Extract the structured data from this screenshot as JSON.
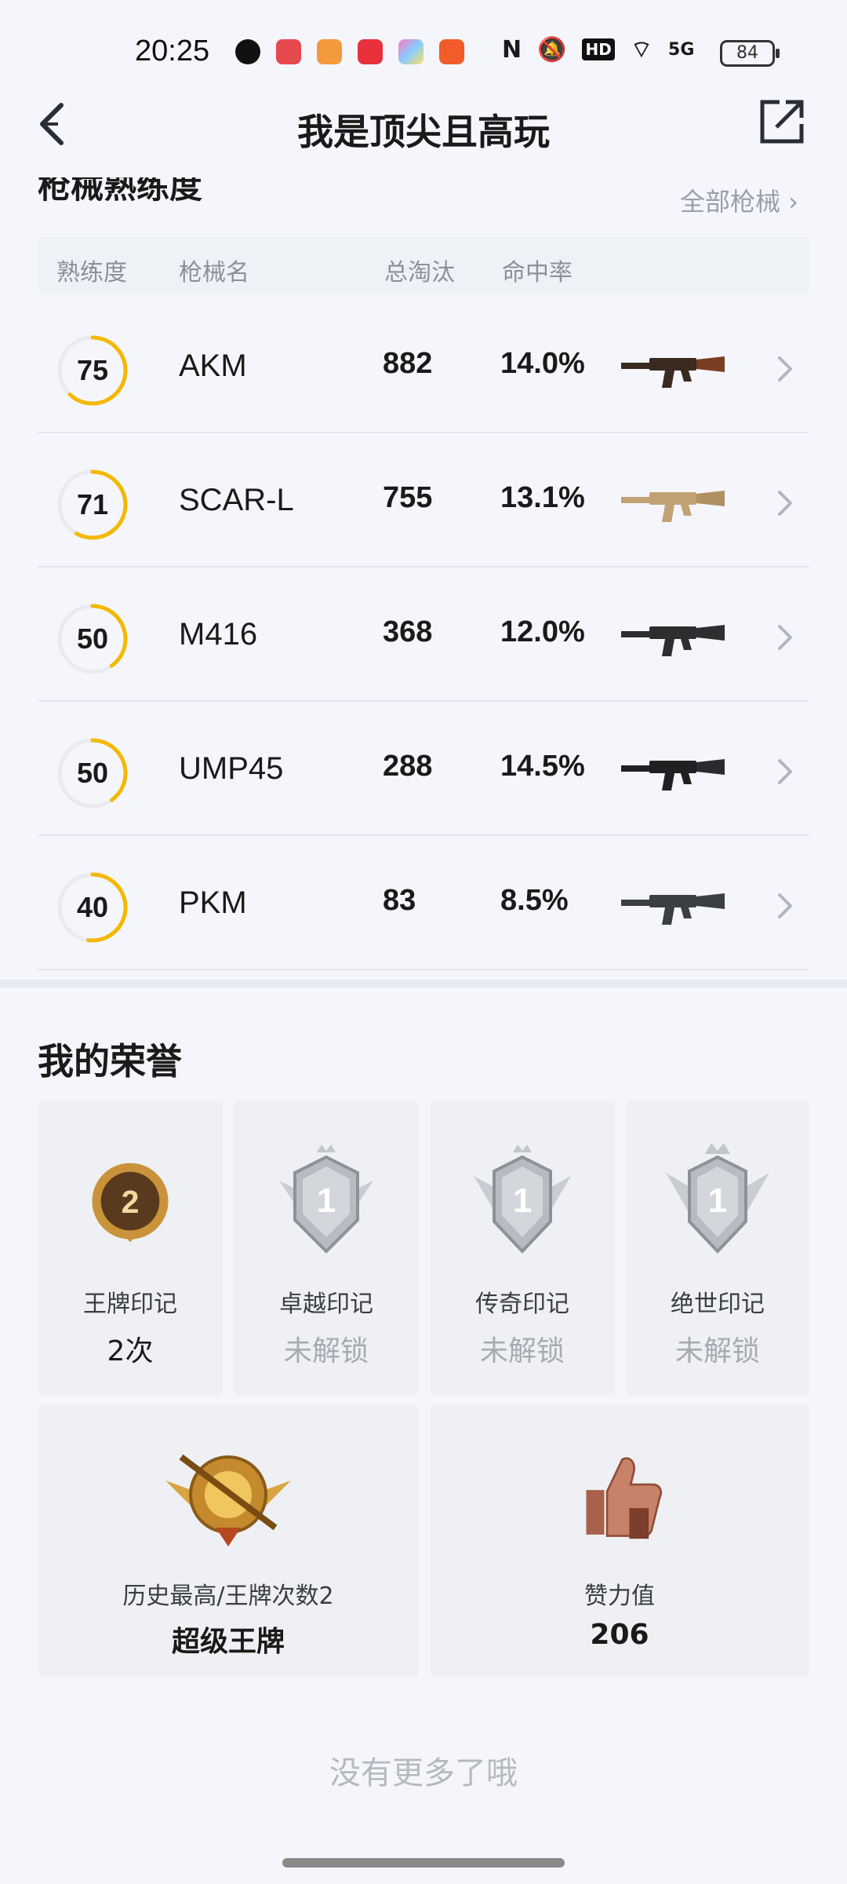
{
  "status": {
    "time": "20:25",
    "network": "5G",
    "battery": "84",
    "hd": "HD"
  },
  "header": {
    "title": "我是顶尖且高玩"
  },
  "weapons": {
    "section_title": "枪械熟练度",
    "all_link": "全部枪械 ›",
    "columns": [
      "熟练度",
      "枪械名",
      "总淘汰",
      "命中率"
    ],
    "rows": [
      {
        "proficiency": "75",
        "proficiency_fraction": 0.62,
        "name": "AKM",
        "kills": "882",
        "accuracy": "14.0%"
      },
      {
        "proficiency": "71",
        "proficiency_fraction": 0.58,
        "name": "SCAR-L",
        "kills": "755",
        "accuracy": "13.1%"
      },
      {
        "proficiency": "50",
        "proficiency_fraction": 0.4,
        "name": "M416",
        "kills": "368",
        "accuracy": "12.0%"
      },
      {
        "proficiency": "50",
        "proficiency_fraction": 0.4,
        "name": "UMP45",
        "kills": "288",
        "accuracy": "14.5%"
      },
      {
        "proficiency": "40",
        "proficiency_fraction": 0.52,
        "name": "PKM",
        "kills": "83",
        "accuracy": "8.5%"
      }
    ]
  },
  "honors": {
    "title": "我的荣誉",
    "cards": [
      {
        "label": "王牌印记",
        "value": "2次",
        "locked": false,
        "badge": "2"
      },
      {
        "label": "卓越印记",
        "value": "未解锁",
        "locked": true,
        "badge": "1"
      },
      {
        "label": "传奇印记",
        "value": "未解锁",
        "locked": true,
        "badge": "1"
      },
      {
        "label": "绝世印记",
        "value": "未解锁",
        "locked": true,
        "badge": "1"
      }
    ],
    "wide_cards": [
      {
        "label": "历史最高/王牌次数2",
        "value": "超级王牌"
      },
      {
        "label": "赞力值",
        "value": "206"
      }
    ]
  },
  "footer": {
    "no_more": "没有更多了哦"
  },
  "colors": {
    "accent": "#f5b800",
    "ring_track": "#e9ebef"
  }
}
